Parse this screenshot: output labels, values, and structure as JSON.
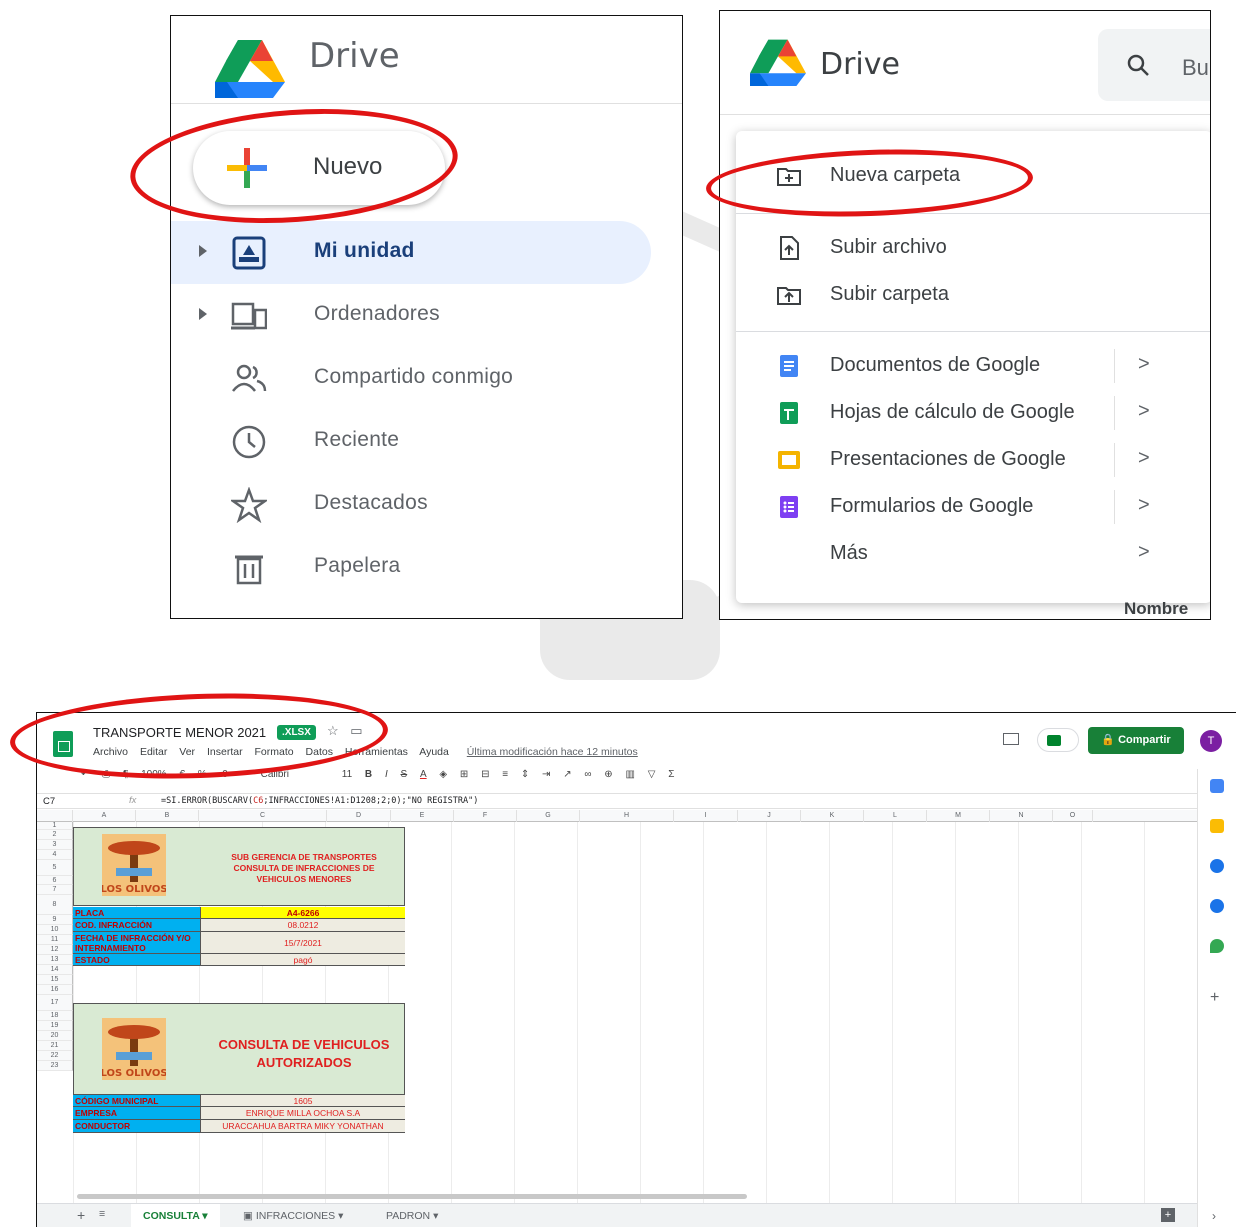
{
  "drive_left": {
    "brand": "Drive",
    "new_button": "Nuevo",
    "nav": [
      {
        "label": "Mi unidad",
        "icon": "my-drive-icon",
        "active": true
      },
      {
        "label": "Ordenadores",
        "icon": "computers-icon"
      },
      {
        "label": "Compartido conmigo",
        "icon": "shared-icon"
      },
      {
        "label": "Reciente",
        "icon": "clock-icon"
      },
      {
        "label": "Destacados",
        "icon": "star-icon"
      },
      {
        "label": "Papelera",
        "icon": "trash-icon"
      }
    ]
  },
  "drive_right": {
    "brand": "Drive",
    "search_partial": "Bu",
    "menu": [
      {
        "label": "Nueva carpeta",
        "icon": "new-folder-icon"
      },
      {
        "label": "Subir archivo",
        "icon": "upload-file-icon"
      },
      {
        "label": "Subir carpeta",
        "icon": "upload-folder-icon"
      },
      {
        "label": "Documentos de Google",
        "icon": "docs-icon",
        "color": "#4285f4"
      },
      {
        "label": "Hojas de cálculo de Google",
        "icon": "sheets-icon",
        "color": "#0f9d58"
      },
      {
        "label": "Presentaciones de Google",
        "icon": "slides-icon",
        "color": "#f4b400"
      },
      {
        "label": "Formularios de Google",
        "icon": "forms-icon",
        "color": "#7e3ff2"
      },
      {
        "label": "Más",
        "icon": "none"
      }
    ],
    "chevron": ">",
    "column_header": "Nombre"
  },
  "sheet": {
    "title": "TRANSPORTE MENOR 2021",
    "format_badge": ".XLSX",
    "menus": [
      "Archivo",
      "Editar",
      "Ver",
      "Insertar",
      "Formato",
      "Datos",
      "Herramientas",
      "Ayuda"
    ],
    "last_modified": "Última modificación hace 12 minutos",
    "share": "Compartir",
    "avatar": "T",
    "zoom": "100%",
    "font": "Calibri",
    "font_size": "11",
    "cell_ref": "C7",
    "formula_prefix": "=SI.ERROR(BUSCARV(",
    "formula_ref": "C6",
    "formula_suffix": ";INFRACCIONES!A1:D1208;2;0);\"NO REGISTRA\")",
    "columns": [
      "A",
      "B",
      "C",
      "D",
      "E",
      "F",
      "G",
      "H",
      "I",
      "J",
      "K",
      "L",
      "M",
      "N",
      "O"
    ],
    "rows": [
      "1",
      "2",
      "3",
      "4",
      "5",
      "6",
      "7",
      "8",
      "9",
      "10",
      "11",
      "12",
      "13",
      "14",
      "15",
      "16",
      "17",
      "18",
      "19",
      "20",
      "21",
      "22",
      "23"
    ],
    "logo_text": "LOS OLIVOS",
    "block1_title": "SUB GERENCIA DE TRANSPORTES\nCONSULTA DE INFRACCIONES DE\nVEHICULOS MENORES",
    "block1_rows": [
      {
        "key": "PLACA",
        "value": "A4-6266"
      },
      {
        "key": "COD. INFRACCIÓN",
        "value": "08.0212"
      },
      {
        "key": "FECHA DE INFRACCIÓN Y/O INTERNAMIENTO",
        "value": "15/7/2021"
      },
      {
        "key": "ESTADO",
        "value": "pagó"
      }
    ],
    "block2_title": "CONSULTA DE VEHICULOS\nAUTORIZADOS",
    "block2_rows": [
      {
        "key": "CÓDIGO MUNICIPAL",
        "value": "1605"
      },
      {
        "key": "EMPRESA",
        "value": "ENRIQUE MILLA OCHOA S.A"
      },
      {
        "key": "CONDUCTOR",
        "value": "URACCAHUA BARTRA MIKY YONATHAN"
      }
    ],
    "tabs": [
      "CONSULTA",
      "INFRACCIONES",
      "PADRON"
    ]
  }
}
